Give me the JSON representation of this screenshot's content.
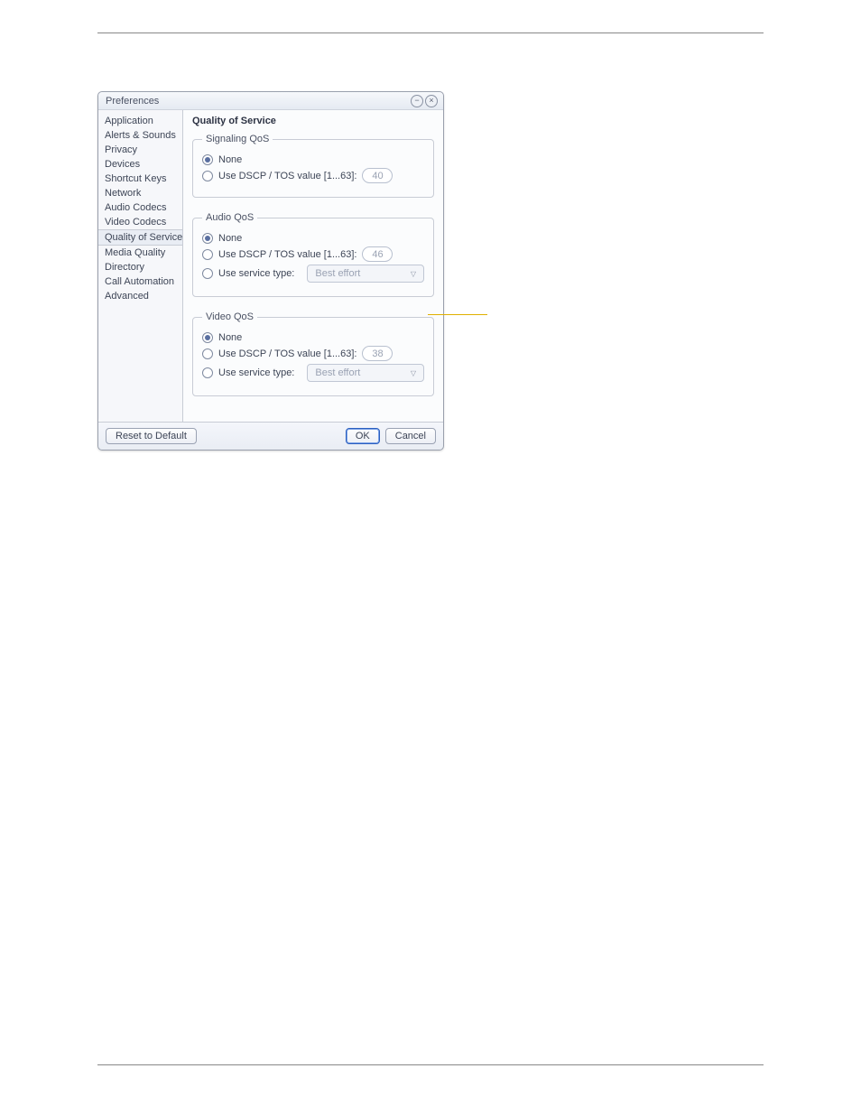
{
  "window": {
    "title": "Preferences"
  },
  "sidebar": {
    "items": [
      {
        "label": "Application"
      },
      {
        "label": "Alerts & Sounds"
      },
      {
        "label": "Privacy"
      },
      {
        "label": "Devices"
      },
      {
        "label": "Shortcut Keys"
      },
      {
        "label": "Network"
      },
      {
        "label": "Audio Codecs"
      },
      {
        "label": "Video Codecs"
      },
      {
        "label": "Quality of Service",
        "selected": true
      },
      {
        "label": "Media Quality"
      },
      {
        "label": "Directory"
      },
      {
        "label": "Call Automation"
      },
      {
        "label": "Advanced"
      }
    ]
  },
  "panel": {
    "title": "Quality of Service",
    "signaling": {
      "legend": "Signaling QoS",
      "none": "None",
      "dscp_label": "Use DSCP / TOS value [1...63]:",
      "dscp_value": "40"
    },
    "audio": {
      "legend": "Audio QoS",
      "none": "None",
      "dscp_label": "Use DSCP / TOS value [1...63]:",
      "dscp_value": "46",
      "svc_label": "Use service type:",
      "svc_value": "Best effort"
    },
    "video": {
      "legend": "Video QoS",
      "none": "None",
      "dscp_label": "Use DSCP / TOS value [1...63]:",
      "dscp_value": "38",
      "svc_label": "Use service type:",
      "svc_value": "Best effort"
    }
  },
  "footer": {
    "reset": "Reset to Default",
    "ok": "OK",
    "cancel": "Cancel"
  }
}
